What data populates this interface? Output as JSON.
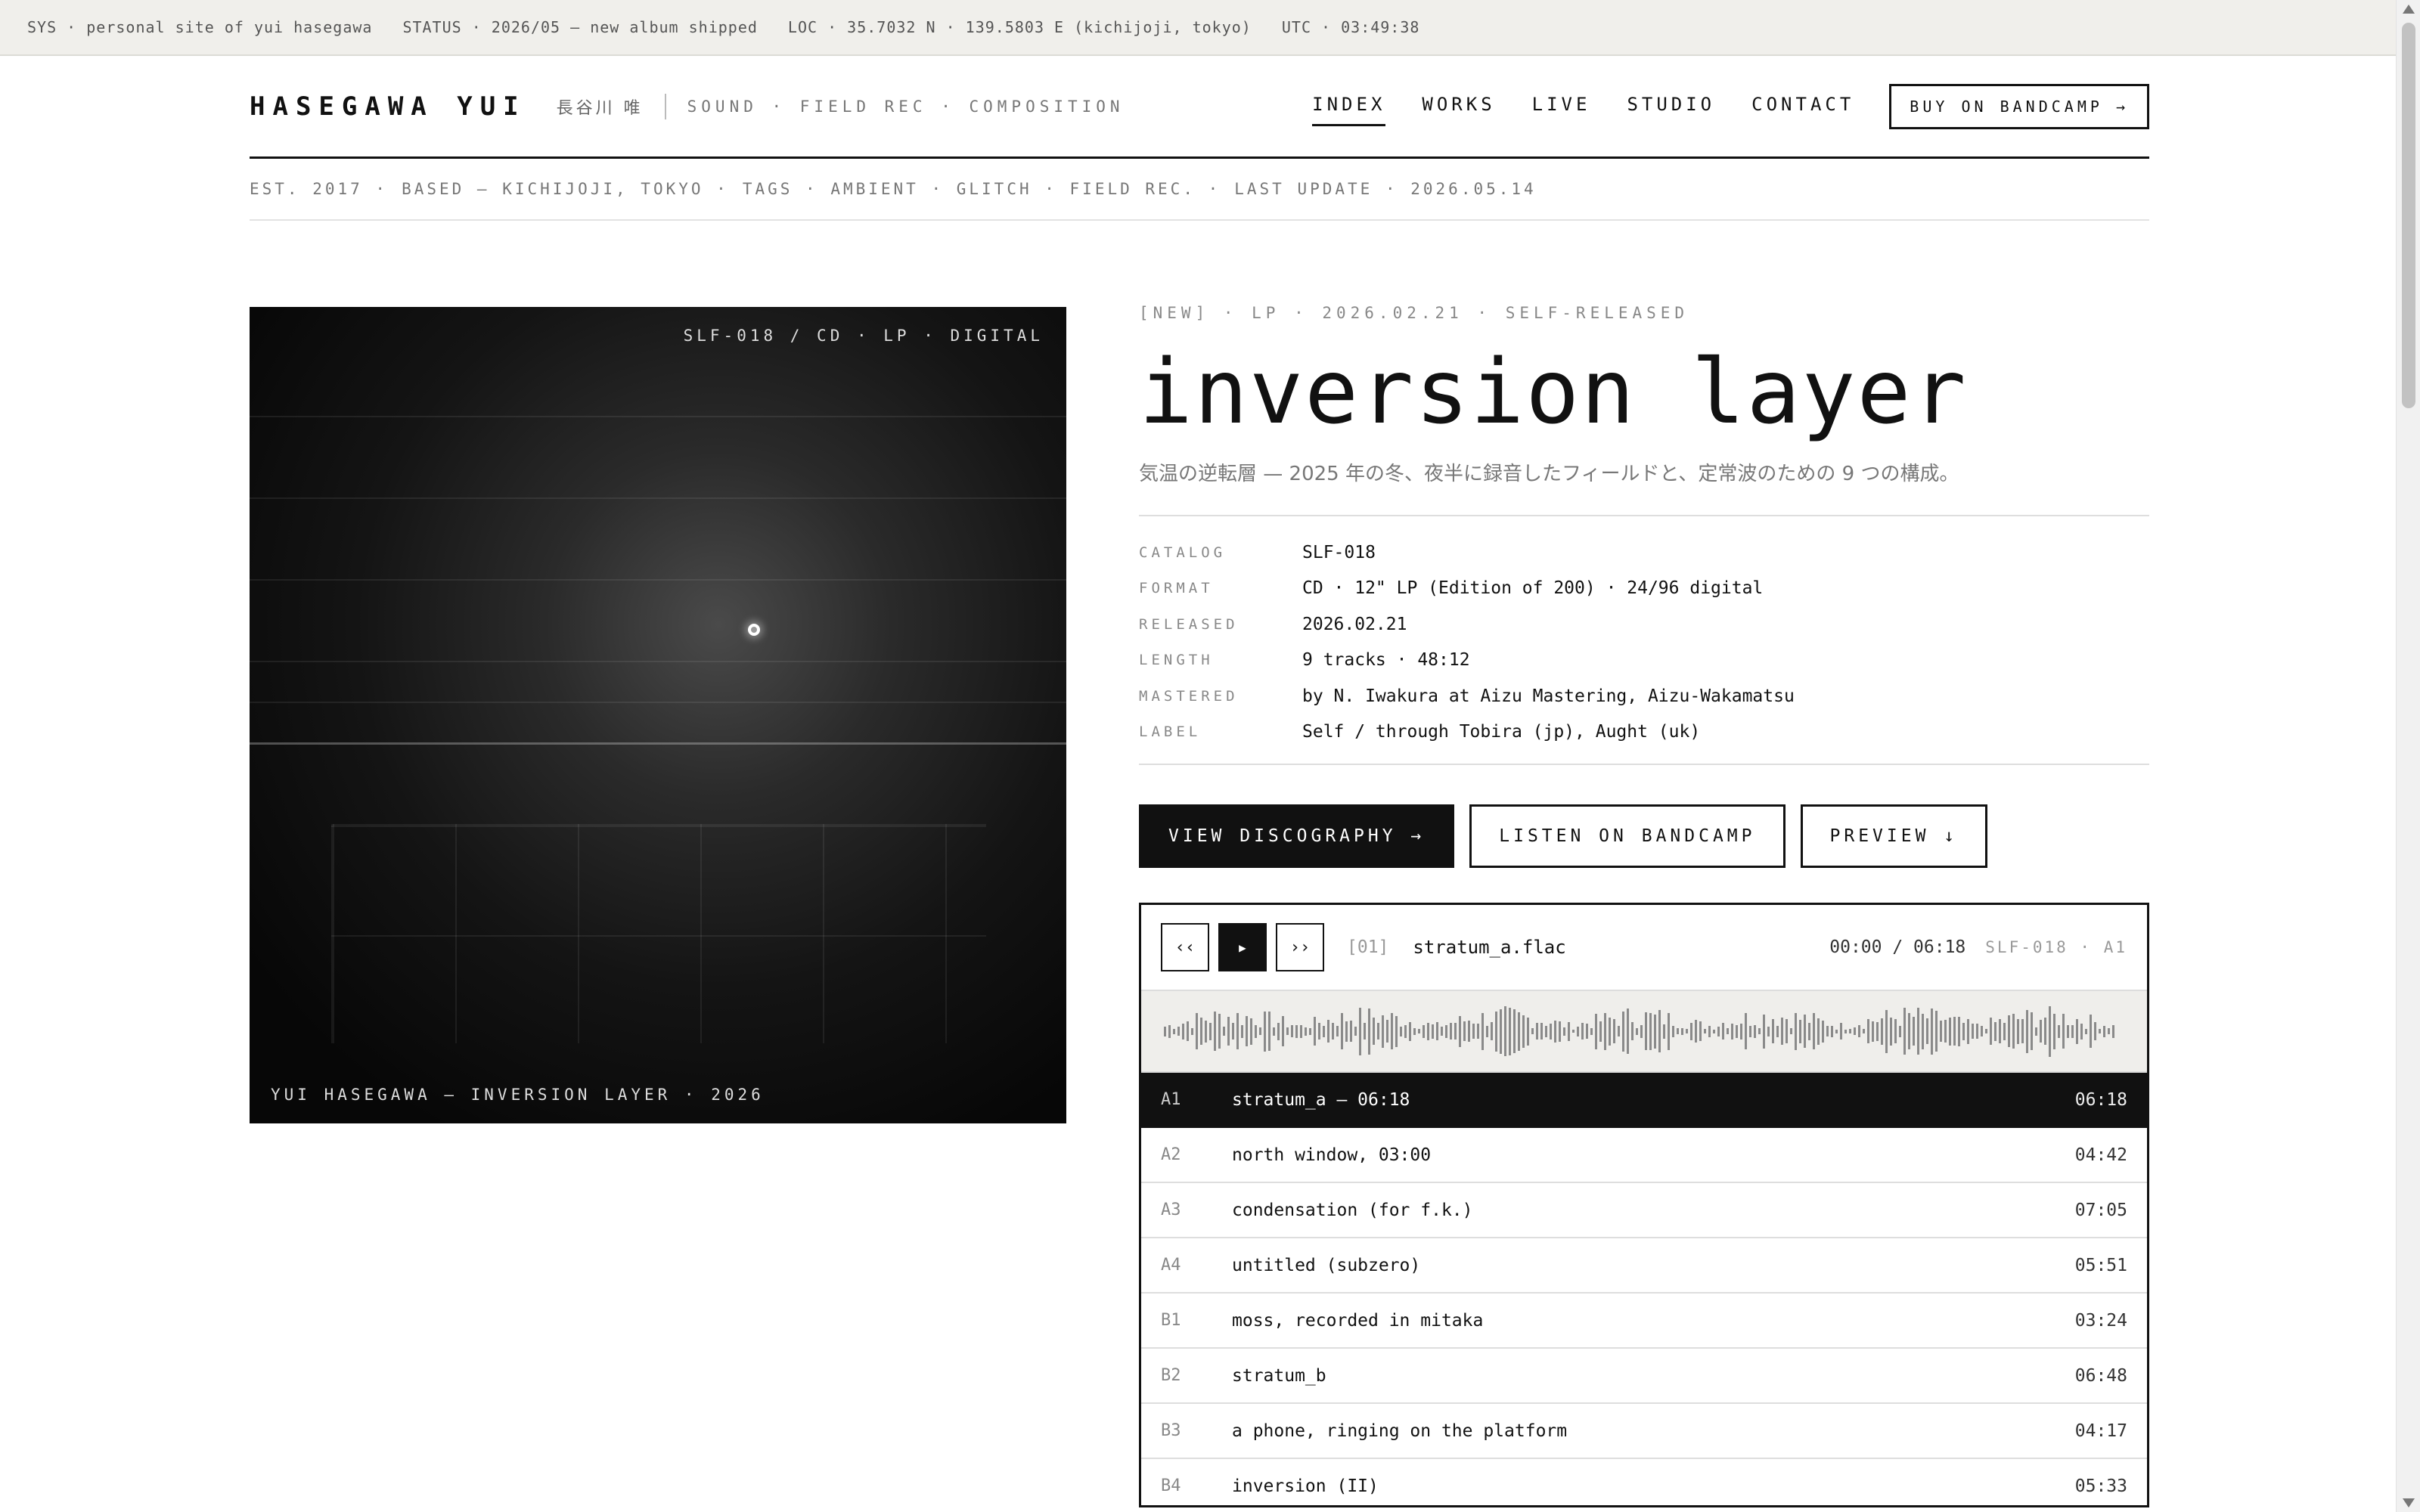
{
  "sysbar": {
    "sys": "SYS · personal site of yui hasegawa",
    "status": "STATUS · 2026/05 — new album shipped",
    "loc": "LOC · 35.7032 N · 139.5803 E (kichijoji, tokyo)",
    "utc": "UTC · 03:49:38"
  },
  "header": {
    "brand": "HASEGAWA YUI",
    "brand_jp": "長谷川 唯",
    "tagline": "SOUND · FIELD REC · COMPOSITION",
    "nav": [
      "INDEX",
      "WORKS",
      "LIVE",
      "STUDIO",
      "CONTACT"
    ],
    "active_nav": "INDEX",
    "buy_label": "BUY ON BANDCAMP →"
  },
  "meta": {
    "est": "EST. 2017 ·",
    "based": "BASED — KICHIJOJI, TOKYO ·",
    "tags": "TAGS · AMBIENT · GLITCH · FIELD REC. ·",
    "updated": "LAST UPDATE · 2026.05.14"
  },
  "cover": {
    "catalog_line": "SLF-018 / CD · LP · DIGITAL",
    "credit_line": "YUI HASEGAWA — INVERSION LAYER · 2026"
  },
  "release": {
    "kicker": "[NEW] · LP · 2026.02.21 · SELF-RELEASED",
    "title": "inversion layer",
    "subtitle": "気温の逆転層 — 2025 年の冬、夜半に録音したフィールドと、定常波のための 9 つの構成。",
    "specs": [
      {
        "key": "CATALOG",
        "value": "SLF-018"
      },
      {
        "key": "FORMAT",
        "value": "CD · 12\" LP (Edition of 200) · 24/96 digital"
      },
      {
        "key": "RELEASED",
        "value": "2026.02.21"
      },
      {
        "key": "LENGTH",
        "value": "9 tracks · 48:12"
      },
      {
        "key": "MASTERED",
        "value": "by N. Iwakura at Aizu Mastering, Aizu-Wakamatsu"
      },
      {
        "key": "LABEL",
        "value": "Self / through Tobira (jp), Aught (uk)"
      }
    ]
  },
  "actions": {
    "discography": "VIEW DISCOGRAPHY →",
    "bandcamp": "LISTEN ON BANDCAMP",
    "preview": "PREVIEW ↓"
  },
  "player": {
    "prev_icon": "‹‹",
    "play_icon": "▶",
    "next_icon": "››",
    "track_num": "[01]",
    "file": "stratum_a.flac",
    "time": "00:00 / 06:18",
    "catalog": "SLF-018 · A1",
    "tracks": [
      {
        "side": "A1",
        "name": "stratum_a — 06:18",
        "dur": "06:18"
      },
      {
        "side": "A2",
        "name": "north window, 03:00",
        "dur": "04:42"
      },
      {
        "side": "A3",
        "name": "condensation (for f.k.)",
        "dur": "07:05"
      },
      {
        "side": "A4",
        "name": "untitled (subzero)",
        "dur": "05:51"
      },
      {
        "side": "B1",
        "name": "moss, recorded in mitaka",
        "dur": "03:24"
      },
      {
        "side": "B2",
        "name": "stratum_b",
        "dur": "06:48"
      },
      {
        "side": "B3",
        "name": "a phone, ringing on the platform",
        "dur": "04:17"
      },
      {
        "side": "B4",
        "name": "inversion (II)",
        "dur": "05:33"
      }
    ]
  }
}
